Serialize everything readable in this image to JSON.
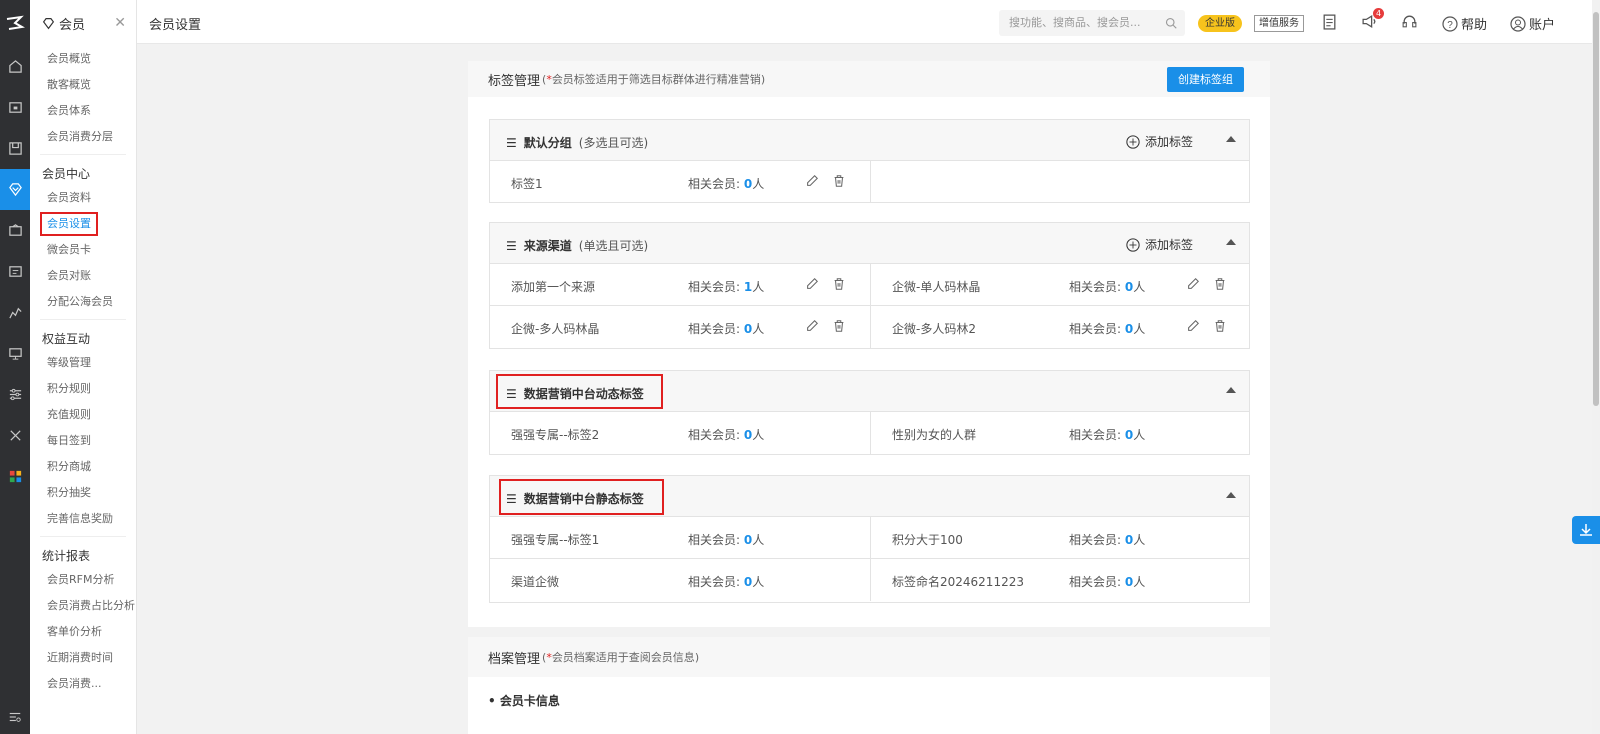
{
  "rail": {
    "icons": [
      "home-icon",
      "shop-icon",
      "goods-icon",
      "member-icon",
      "marketing-icon",
      "card-icon",
      "report-icon",
      "screen-icon",
      "settings-icon",
      "tools-icon",
      "apps-icon"
    ]
  },
  "submenu": {
    "title": "会员",
    "items_top": [
      "会员概览",
      "散客概览",
      "会员体系",
      "会员消费分层"
    ],
    "group1": "会员中心",
    "group1_items": [
      "会员资料",
      "会员设置",
      "微会员卡",
      "会员对账",
      "分配公海会员"
    ],
    "group2": "权益互动",
    "group2_items": [
      "等级管理",
      "积分规则",
      "充值规则",
      "每日签到",
      "积分商城",
      "积分抽奖",
      "完善信息奖励"
    ],
    "group3": "统计报表",
    "group3_items": [
      "会员RFM分析",
      "会员消费占比分析",
      "客单价分析",
      "近期消费时间",
      "会员消费..."
    ]
  },
  "topbar": {
    "title": "会员设置",
    "search_placeholder": "搜功能、搜商品、搜会员...",
    "enterprise": "企业版",
    "vas": "增值服务",
    "notif_count": "4",
    "help": "帮助",
    "account": "账户"
  },
  "tag_mgmt": {
    "title": "标签管理",
    "note_star": "*",
    "note": "会员标签适用于筛选目标群体进行精准营销",
    "create_btn": "创建标签组",
    "add_tag": "添加标签",
    "count_label": "相关会员:",
    "unit": "人",
    "groups": [
      {
        "title": "默认分组",
        "sub": "(多选且可选)",
        "rows": [
          [
            {
              "name": "标签1",
              "count": "0"
            }
          ]
        ]
      },
      {
        "title": "来源渠道",
        "sub": "(单选且可选)",
        "rows": [
          [
            {
              "name": "添加第一个来源",
              "count": "1"
            },
            {
              "name": "企微-单人码林晶",
              "count": "0"
            }
          ],
          [
            {
              "name": "企微-多人码林晶",
              "count": "0"
            },
            {
              "name": "企微-多人码林2",
              "count": "0"
            }
          ]
        ]
      },
      {
        "title": "数据营销中台动态标签",
        "sub": "",
        "rows": [
          [
            {
              "name": "强强专属--标签2",
              "count": "0"
            },
            {
              "name": "性别为女的人群",
              "count": "0"
            }
          ]
        ]
      },
      {
        "title": "数据营销中台静态标签",
        "sub": "",
        "rows": [
          [
            {
              "name": "强强专属--标签1",
              "count": "0"
            },
            {
              "name": "积分大于100",
              "count": "0"
            }
          ],
          [
            {
              "name": "渠道企微",
              "count": "0"
            },
            {
              "name": "标签命名20246211223",
              "count": "0"
            }
          ]
        ]
      }
    ]
  },
  "file_mgmt": {
    "title": "档案管理",
    "note_star": "*",
    "note": "会员档案适用于查阅会员信息",
    "section": "• 会员卡信息"
  }
}
